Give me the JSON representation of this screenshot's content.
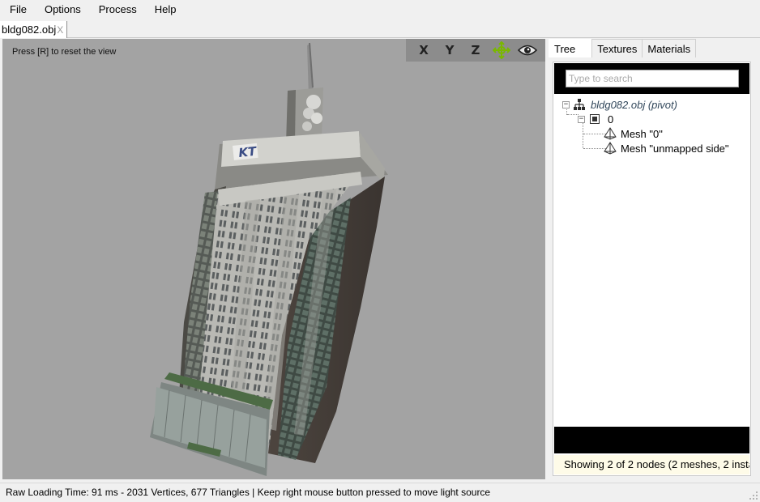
{
  "menu": [
    "File",
    "Options",
    "Process",
    "Help"
  ],
  "document_tab": {
    "label": "bldg082.obj",
    "close": "X"
  },
  "viewport": {
    "hint": "Press [R] to reset the view",
    "toolbar": {
      "x": "X",
      "y": "Y",
      "z": "Z",
      "move_icon": "move-light-icon",
      "eye_icon": "eye-icon"
    },
    "building_sign": "KT"
  },
  "side_tabs": [
    "Tree",
    "Textures",
    "Materials"
  ],
  "search": {
    "placeholder": "Type to search",
    "value": ""
  },
  "tree": {
    "root": "bldg082.obj (pivot)",
    "node0": "0",
    "mesh0": "Mesh \"0\"",
    "mesh1": "Mesh \"unmapped side\""
  },
  "node_status": "Showing 2 of 2 nodes (2 meshes, 2 instan",
  "statusbar": "Raw Loading Time: 91 ms - 2031 Vertices, 677 Triangles  | Keep right mouse button pressed to move light source",
  "colors": {
    "viewport_bg": "#a3a3a3",
    "move_icon": "#7ab800",
    "status_bg": "#fefbe8"
  }
}
